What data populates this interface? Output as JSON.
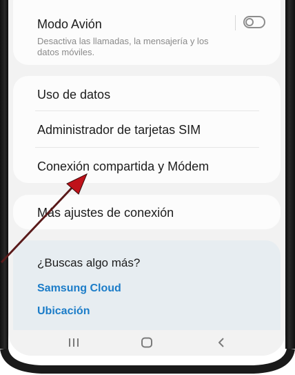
{
  "settings": {
    "airplane": {
      "title": "Modo Avión",
      "subtitle_line1": "Desactiva las llamadas, la mensajería y los",
      "subtitle_line2": "datos móviles.",
      "toggle_state": "off"
    },
    "group": [
      {
        "label": "Uso de datos"
      },
      {
        "label": "Administrador de tarjetas SIM"
      },
      {
        "label": "Conexión compartida y Módem"
      }
    ],
    "more": {
      "label": "Más ajustes de conexión"
    }
  },
  "suggestions": {
    "heading": "¿Buscas algo más?",
    "links": [
      "Samsung Cloud",
      "Ubicación"
    ]
  },
  "navbar": {
    "recent_icon": "recent-apps-icon",
    "home_icon": "home-icon",
    "back_icon": "back-icon"
  },
  "colors": {
    "link": "#1b7cc8",
    "arrow": "#c0121a",
    "card_suggest": "#e7edf1"
  }
}
